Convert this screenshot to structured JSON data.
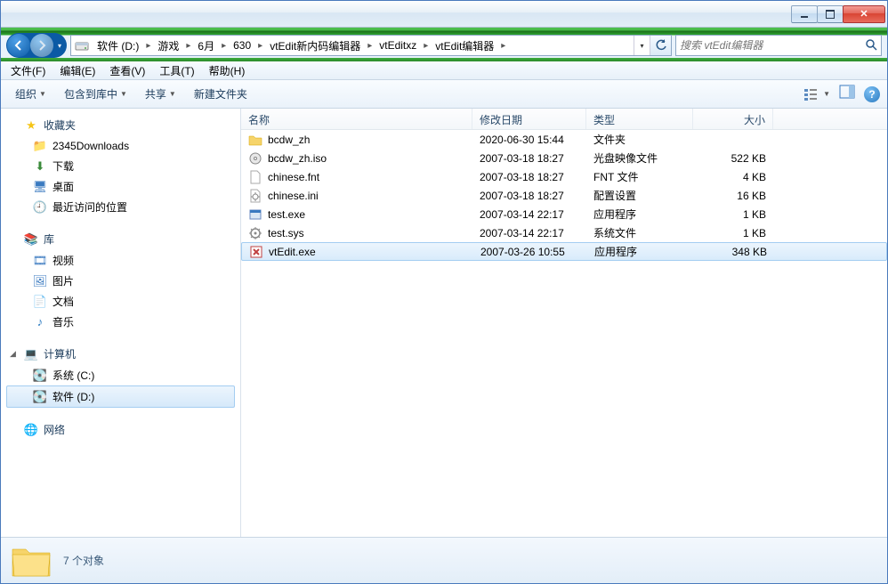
{
  "breadcrumb": {
    "items": [
      "软件 (D:)",
      "游戏",
      "6月",
      "630",
      "vtEdit新内码编辑器",
      "vtEditxz",
      "vtEdit编辑器"
    ]
  },
  "search": {
    "placeholder": "搜索 vtEdit编辑器"
  },
  "menubar": {
    "file": "文件(F)",
    "edit": "编辑(E)",
    "view": "查看(V)",
    "tools": "工具(T)",
    "help": "帮助(H)"
  },
  "toolbar": {
    "organize": "组织",
    "include": "包含到库中",
    "share": "共享",
    "newfolder": "新建文件夹"
  },
  "sidebar": {
    "fav": {
      "label": "收藏夹",
      "items": [
        "2345Downloads",
        "下载",
        "桌面",
        "最近访问的位置"
      ]
    },
    "lib": {
      "label": "库",
      "items": [
        "视频",
        "图片",
        "文档",
        "音乐"
      ]
    },
    "comp": {
      "label": "计算机",
      "items": [
        "系统 (C:)",
        "软件 (D:)"
      ]
    },
    "net": {
      "label": "网络"
    }
  },
  "columns": {
    "name": "名称",
    "date": "修改日期",
    "type": "类型",
    "size": "大小"
  },
  "files": [
    {
      "name": "bcdw_zh",
      "date": "2020-06-30 15:44",
      "type": "文件夹",
      "size": "",
      "icon": "folder"
    },
    {
      "name": "bcdw_zh.iso",
      "date": "2007-03-18 18:27",
      "type": "光盘映像文件",
      "size": "522 KB",
      "icon": "iso"
    },
    {
      "name": "chinese.fnt",
      "date": "2007-03-18 18:27",
      "type": "FNT 文件",
      "size": "4 KB",
      "icon": "file"
    },
    {
      "name": "chinese.ini",
      "date": "2007-03-18 18:27",
      "type": "配置设置",
      "size": "16 KB",
      "icon": "ini"
    },
    {
      "name": "test.exe",
      "date": "2007-03-14 22:17",
      "type": "应用程序",
      "size": "1 KB",
      "icon": "exe"
    },
    {
      "name": "test.sys",
      "date": "2007-03-14 22:17",
      "type": "系统文件",
      "size": "1 KB",
      "icon": "sys"
    },
    {
      "name": "vtEdit.exe",
      "date": "2007-03-26 10:55",
      "type": "应用程序",
      "size": "348 KB",
      "icon": "app",
      "selected": true
    }
  ],
  "status": {
    "count": "7 个对象"
  }
}
